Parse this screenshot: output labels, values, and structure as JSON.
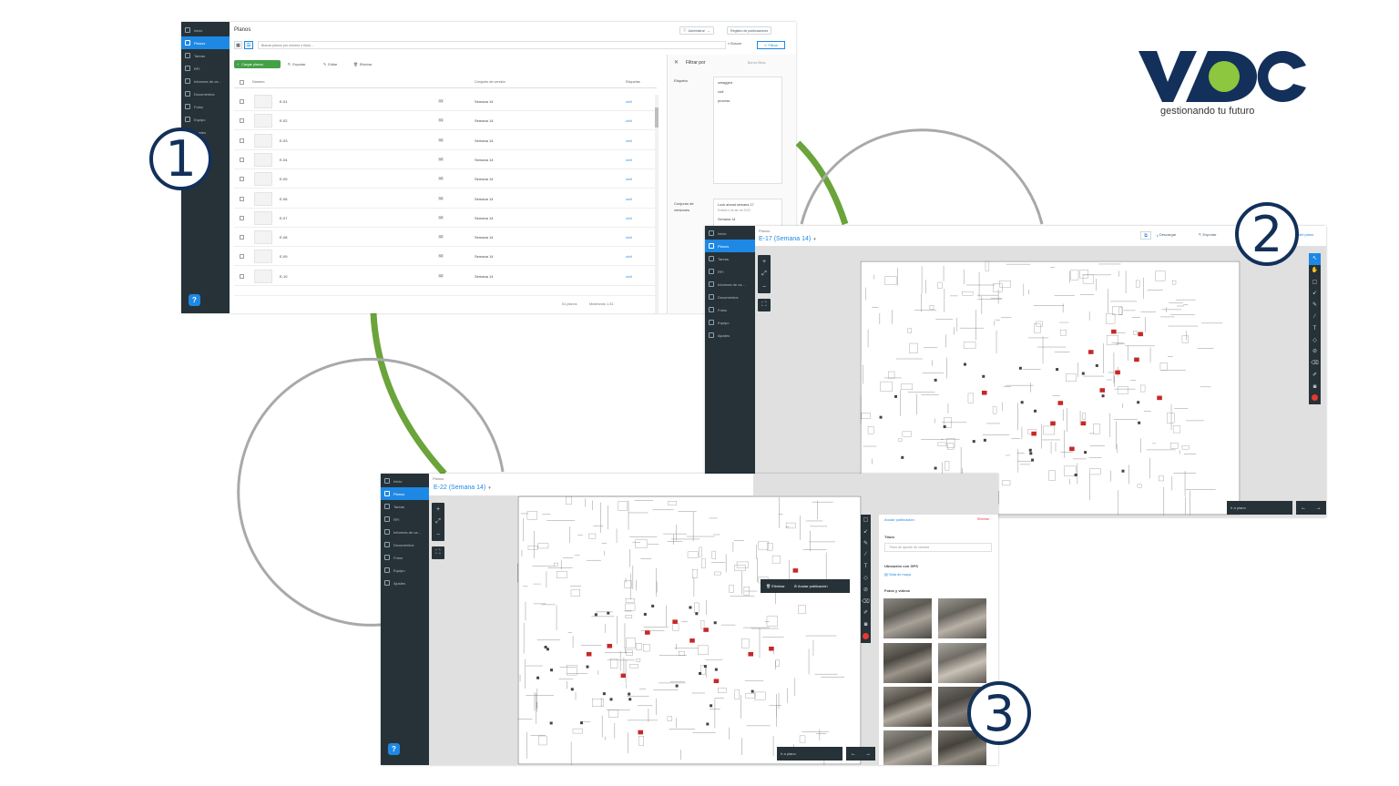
{
  "logo": {
    "text": "VDC",
    "tagline": "gestionando tu futuro"
  },
  "steps": [
    "1",
    "2",
    "3"
  ],
  "nav": {
    "items": [
      "Inicio",
      "Planos",
      "Tareas",
      "RFI",
      "Informes de ca...",
      "Documentos",
      "Fotos",
      "Equipo",
      "Ajustes"
    ],
    "help": "?"
  },
  "win1": {
    "title": "Planos",
    "admin_button": "Administrar",
    "registro_button": "Registro de publicaciones",
    "search_placeholder": "Buscar planos por número o título...",
    "search_button": "Buscar",
    "filters_button": "Filtros",
    "load_button": "Cargar planos",
    "export_button": "Exportar",
    "edit_button": "Editar",
    "delete_button": "Eliminar",
    "columns": {
      "number": "Número",
      "set": "Conjunto de versión",
      "tags": "Etiquetas"
    },
    "rows": [
      {
        "number": "E-01",
        "version": "V1",
        "set": "Semana 14",
        "tag": "civil"
      },
      {
        "number": "E-02",
        "version": "V1",
        "set": "Semana 14",
        "tag": "civil"
      },
      {
        "number": "E-03",
        "version": "V2",
        "set": "Semana 14",
        "tag": "civil"
      },
      {
        "number": "E-04",
        "version": "V2",
        "set": "Semana 14",
        "tag": "civil"
      },
      {
        "number": "E-05",
        "version": "V2",
        "set": "Semana 14",
        "tag": "civil"
      },
      {
        "number": "E-06",
        "version": "V2",
        "set": "Semana 14",
        "tag": "civil"
      },
      {
        "number": "E-07",
        "version": "V2",
        "set": "Semana 14",
        "tag": "civil"
      },
      {
        "number": "E-08",
        "version": "V2",
        "set": "Semana 14",
        "tag": "civil"
      },
      {
        "number": "E-09",
        "version": "V2",
        "set": "Semana 14",
        "tag": "civil"
      },
      {
        "number": "E-10",
        "version": "V2",
        "set": "Semana 14",
        "tag": "civil"
      }
    ],
    "footer_count": "51 planos",
    "footer_showing": "Mostrando 1-51",
    "filter": {
      "title": "Filtrar por",
      "clear": "Borrar filtros",
      "tags_label": "Etiqueta",
      "tag_options": [
        "untagged",
        "civil",
        "process"
      ],
      "sets_label": "Conjunto de versiones",
      "set_name": "Look ahead semana 17",
      "set_date": "Emitido 4 de abr de 2023",
      "set_option": "Semana 14"
    }
  },
  "win2": {
    "breadcrumb": "Planos",
    "sheet": "E-17 (Semana 14)",
    "download": "Descargar",
    "export": "Exportar",
    "plans_link": "del plano",
    "goto": "Ir a plano",
    "sheet_code": "E-17"
  },
  "win3": {
    "breadcrumb": "Planos",
    "sheet": "E-22 (Semana 14)",
    "unpublish_link": "Anular publicación",
    "delete_link": "Eliminar",
    "delete_button": "Eliminar",
    "unpublish_button": "Anular publicación",
    "title_label": "Título",
    "title_placeholder": "Título de apunte de cámara",
    "gps_label": "Ubicación con GPS",
    "map_link": "Vista de mapa",
    "media_label": "Fotos y videos",
    "goto": "Ir a plano"
  },
  "colors": {
    "sidebar": "#263238",
    "accent": "#1e88e5",
    "green_arc": "#6aa43a",
    "gray_arc": "#a9a9a9",
    "badge": "#12305a",
    "logo_blue": "#12305a",
    "logo_green": "#8dc63f"
  }
}
